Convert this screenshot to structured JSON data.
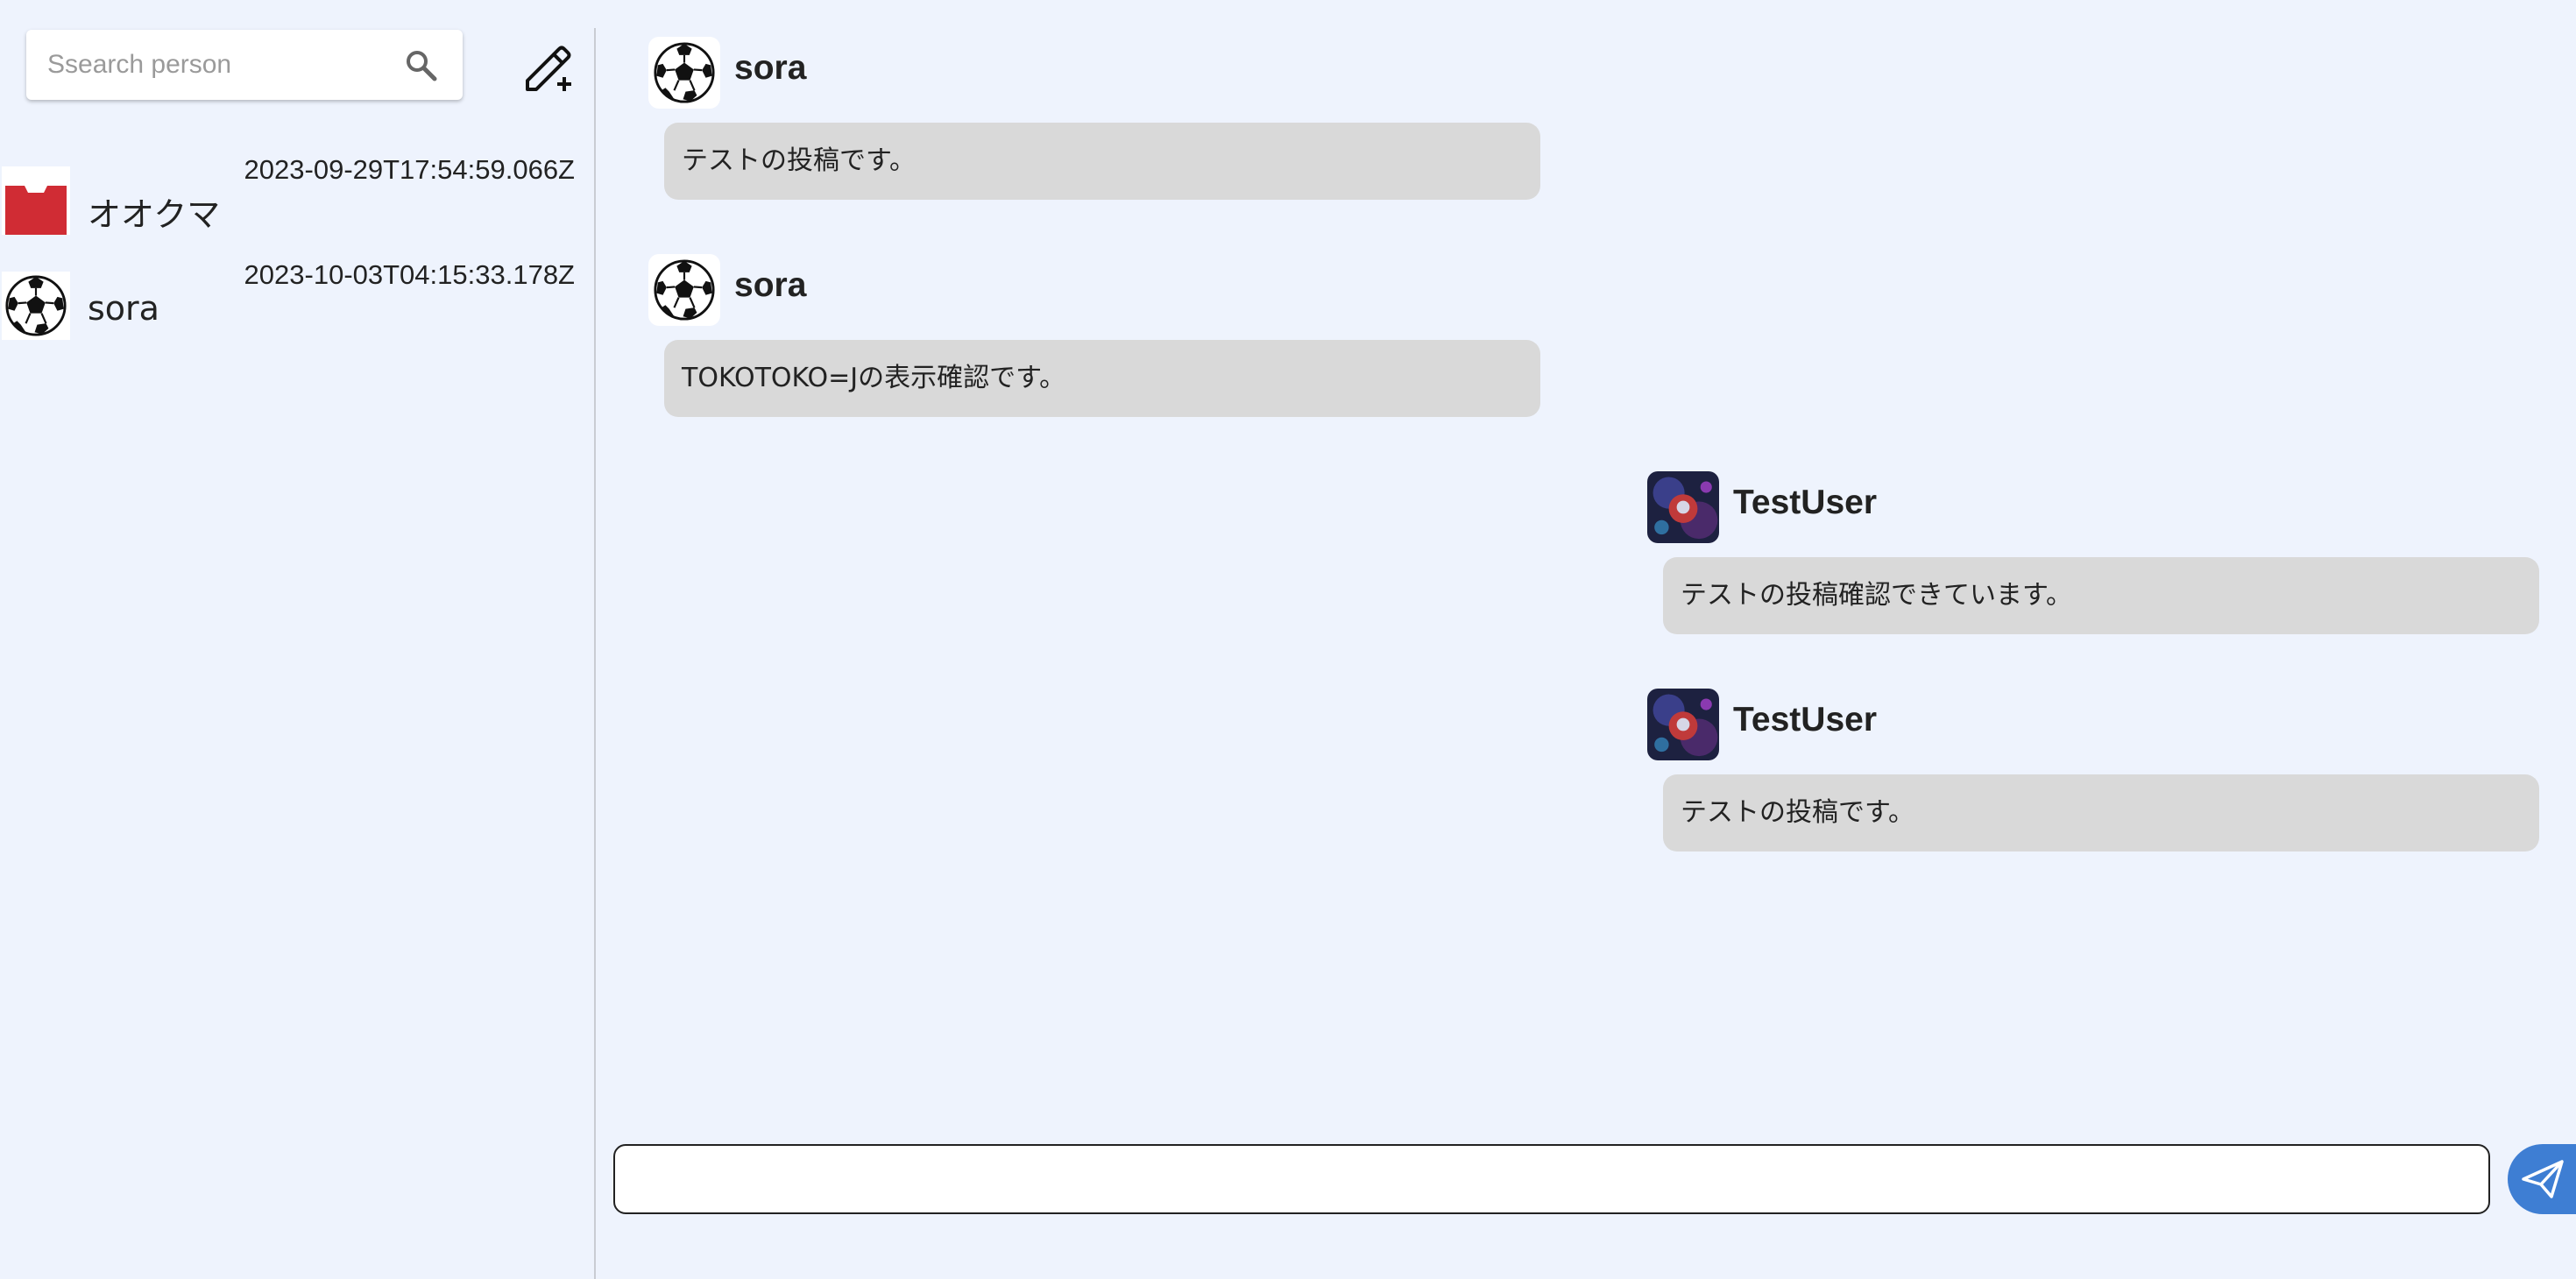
{
  "sidebar": {
    "search": {
      "placeholder": "Ssearch person"
    },
    "contacts": [
      {
        "name": "オオクマ",
        "timestamp": "2023-09-29T17:54:59.066Z",
        "avatar": "red-shirt-icon"
      },
      {
        "name": "sora",
        "timestamp": "2023-10-03T04:15:33.178Z",
        "avatar": "soccer-ball-icon"
      }
    ]
  },
  "chat": {
    "messages": [
      {
        "author": "sora",
        "text": "テストの投稿です。",
        "avatar": "soccer-ball-icon",
        "side": "left"
      },
      {
        "author": "sora",
        "text": "TOKOTOKO=Jの表示確認です。",
        "avatar": "soccer-ball-icon",
        "side": "left"
      },
      {
        "author": "TestUser",
        "text": "テストの投稿確認できています。",
        "avatar": "photo-avatar",
        "side": "right"
      },
      {
        "author": "TestUser",
        "text": "テストの投稿です。",
        "avatar": "photo-avatar",
        "side": "right"
      }
    ],
    "composer": {
      "value": ""
    }
  },
  "colors": {
    "background": "#eef3fd",
    "bubble": "#d9d9d9",
    "send_button": "#3e7ed3"
  }
}
